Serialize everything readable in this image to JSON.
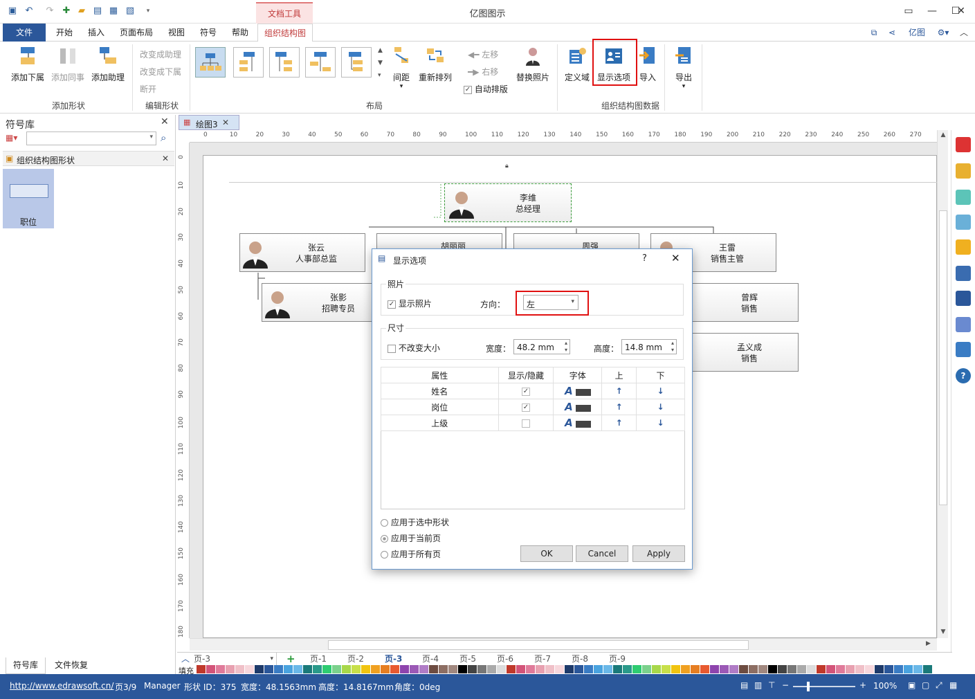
{
  "window": {
    "title": "亿图图示",
    "context_tab": "文档工具"
  },
  "menu": {
    "tabs": [
      "文件",
      "开始",
      "插入",
      "页面布局",
      "视图",
      "符号",
      "帮助",
      "组织结构图"
    ],
    "right": "亿图"
  },
  "ribbon": {
    "add_subordinate": "添加下属",
    "add_colleague": "添加同事",
    "add_assistant": "添加助理",
    "change_to_assistant": "改变成助理",
    "change_to_subordinate": "改变成下属",
    "disconnect": "断开",
    "spacing": "间距",
    "rearrange": "重新排列",
    "move_left": "左移",
    "move_right": "右移",
    "auto_arrange": "自动排版",
    "replace_photo": "替换照片",
    "define_fields": "定义域",
    "display_options": "显示选项",
    "import": "导入",
    "export": "导出",
    "groups": {
      "add_shape": "添加形状",
      "edit_shape": "编辑形状",
      "layout": "布局",
      "org_data": "组织结构图数据"
    }
  },
  "left_panel": {
    "title": "符号库",
    "library": "组织结构图形状",
    "shape_label": "职位",
    "bottom_tabs": [
      "符号库",
      "文件恢复"
    ]
  },
  "document": {
    "tab": "绘图3",
    "ruler_top": [
      "0",
      "10",
      "20",
      "30",
      "40",
      "50",
      "60",
      "70",
      "80",
      "90",
      "100",
      "110",
      "120",
      "130",
      "140",
      "150",
      "160",
      "170",
      "180",
      "190",
      "200",
      "210",
      "220",
      "230",
      "240",
      "250",
      "260",
      "270"
    ],
    "ruler_left": [
      "0",
      "10",
      "20",
      "30",
      "40",
      "50",
      "60",
      "70",
      "80",
      "90",
      "100",
      "110",
      "120",
      "130",
      "140",
      "150",
      "160",
      "170",
      "180"
    ]
  },
  "org": {
    "root": {
      "name": "李维",
      "title": "总经理"
    },
    "row1": [
      {
        "name": "张云",
        "title": "人事部总监"
      },
      {
        "name": "胡丽丽",
        "title": ""
      },
      {
        "name": "周强",
        "title": ""
      },
      {
        "name": "王雷",
        "title": "销售主管"
      }
    ],
    "sub1": {
      "name": "张影",
      "title": "招聘专员"
    },
    "sub4a": {
      "name": "曾辉",
      "title": "销售"
    },
    "sub4b": {
      "name": "孟义成",
      "title": "销售"
    }
  },
  "dialog": {
    "title": "显示选项",
    "help": "?",
    "photo_group": "照片",
    "show_photo": "显示照片",
    "direction_label": "方向：",
    "direction_value": "左",
    "size_group": "尺寸",
    "keep_size": "不改变大小",
    "width_label": "宽度：",
    "width_value": "48.2 mm",
    "height_label": "高度：",
    "height_value": "14.8 mm",
    "columns": [
      "属性",
      "显示/隐藏",
      "字体",
      "上",
      "下"
    ],
    "rows": [
      {
        "attr": "姓名",
        "visible": true
      },
      {
        "attr": "岗位",
        "visible": true
      },
      {
        "attr": "上级",
        "visible": false
      }
    ],
    "apply_options": [
      "应用于选中形状",
      "应用于当前页",
      "应用于所有页"
    ],
    "ok": "OK",
    "cancel": "Cancel",
    "apply": "Apply"
  },
  "pages": {
    "current": "页-3",
    "tabs": [
      "页-1",
      "页-2",
      "页-3",
      "页-4",
      "页-5",
      "页-6",
      "页-7",
      "页-8",
      "页-9"
    ],
    "fill_label": "填充"
  },
  "status": {
    "url": "http://www.edrawsoft.cn/",
    "page": "页3/9",
    "user": "Manager",
    "shape_id": "形状 ID：375",
    "width": "宽度：48.1563mm",
    "height": "高度：14.8167mm",
    "angle": "角度：0deg",
    "zoom": "100%"
  },
  "colors": {
    "accent": "#2b579a",
    "highlight": "#e01010",
    "context": "#c03a3a"
  }
}
